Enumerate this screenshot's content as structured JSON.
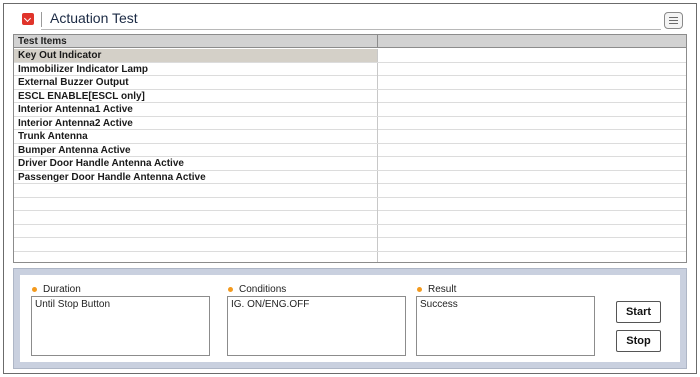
{
  "header": {
    "title": "Actuation Test",
    "icon": "chevron-down-icon",
    "menu_icon": "list-icon",
    "accent_color": "#e0342b"
  },
  "table": {
    "columns": [
      "Test Items",
      ""
    ],
    "rows": [
      "Key Out Indicator",
      "Immobilizer Indicator Lamp",
      "External Buzzer Output",
      "ESCL ENABLE[ESCL only]",
      "Interior Antenna1 Active",
      "Interior Antenna2 Active",
      "Trunk Antenna",
      "Bumper Antenna Active",
      "Driver Door Handle Antenna Active",
      "Passenger Door Handle Antenna Active",
      "",
      "",
      "",
      "",
      "",
      ""
    ],
    "selected_index": 0
  },
  "panel": {
    "duration": {
      "label": "Duration",
      "value": "Until Stop Button"
    },
    "conditions": {
      "label": "Conditions",
      "value": "IG. ON/ENG.OFF"
    },
    "result": {
      "label": "Result",
      "value": "Success"
    },
    "start_label": "Start",
    "stop_label": "Stop",
    "bullet_color": "#f39a1e"
  }
}
